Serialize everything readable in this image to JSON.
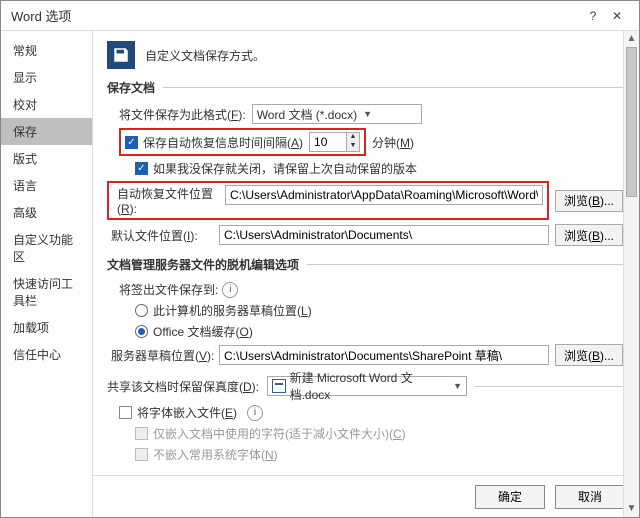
{
  "title": "Word 选项",
  "sidebar": {
    "items": [
      "常规",
      "显示",
      "校对",
      "保存",
      "版式",
      "语言",
      "高级",
      "自定义功能区",
      "快速访问工具栏",
      "加载项",
      "信任中心"
    ],
    "active_index": 3
  },
  "header": {
    "text": "自定义文档保存方式。"
  },
  "section_save": {
    "title": "保存文档",
    "format_label": "将文件保存为此格式(F):",
    "format_value": "Word 文档 (*.docx)",
    "autosave": {
      "checked": true,
      "label_prefix": "保存自动恢复信息时间间隔(A)",
      "value": "10",
      "unit": "分钟(M)"
    },
    "keep_last": {
      "checked": true,
      "label": "如果我没保存就关闭，请保留上次自动保留的版本"
    },
    "recover_path": {
      "label": "自动恢复文件位置(R):",
      "value": "C:\\Users\\Administrator\\AppData\\Roaming\\Microsoft\\Word\\"
    },
    "default_path": {
      "label": "默认文件位置(I):",
      "value": "C:\\Users\\Administrator\\Documents\\"
    },
    "browse": "浏览(B)..."
  },
  "section_offline": {
    "title": "文档管理服务器文件的脱机编辑选项",
    "checkout_label": "将签出文件保存到:",
    "radio1": "此计算机的服务器草稿位置(L)",
    "radio2": "Office 文档缓存(O)",
    "draft_label": "服务器草稿位置(V):",
    "draft_value": "C:\\Users\\Administrator\\Documents\\SharePoint 草稿\\",
    "browse": "浏览(B)..."
  },
  "section_share": {
    "label": "共享该文档时保留保真度(D):",
    "doc_value": "新建 Microsoft Word 文档.docx",
    "embed": {
      "checked": false,
      "label": "将字体嵌入文件(E)"
    },
    "embed_sub1": "仅嵌入文档中使用的字符(适于减小文件大小)(C)",
    "embed_sub2": "不嵌入常用系统字体(N)"
  },
  "footer": {
    "ok": "确定",
    "cancel": "取消"
  }
}
